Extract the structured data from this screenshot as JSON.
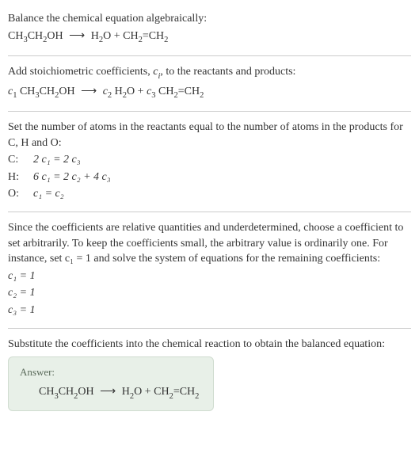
{
  "intro": {
    "line1": "Balance the chemical equation algebraically:",
    "equation_lhs": "CH",
    "equation_lhs2": "CH",
    "equation_lhs3": "OH",
    "equation_rhs1": "H",
    "equation_rhs2": "O + CH",
    "equation_rhs3": "=CH"
  },
  "step1": {
    "text": "Add stoichiometric coefficients, ",
    "ci": "c",
    "ci_sub": "i",
    "text2": ", to the reactants and products:",
    "c1": "c",
    "c2": "c",
    "c3": "c"
  },
  "step2": {
    "text": "Set the number of atoms in the reactants equal to the number of atoms in the products for C, H and O:",
    "rows": [
      {
        "label": "C:",
        "eq": "2 c₁ = 2 c₃"
      },
      {
        "label": "H:",
        "eq": "6 c₁ = 2 c₂ + 4 c₃"
      },
      {
        "label": "O:",
        "eq": "c₁ = c₂"
      }
    ]
  },
  "step3": {
    "text": "Since the coefficients are relative quantities and underdetermined, choose a coefficient to set arbitrarily. To keep the coefficients small, the arbitrary value is ordinarily one. For instance, set c₁ = 1 and solve the system of equations for the remaining coefficients:",
    "results": [
      "c₁ = 1",
      "c₂ = 1",
      "c₃ = 1"
    ]
  },
  "step4": {
    "text": "Substitute the coefficients into the chemical reaction to obtain the balanced equation:"
  },
  "answer": {
    "label": "Answer:"
  },
  "formula": {
    "ethanol_1": "CH",
    "ethanol_2": "CH",
    "ethanol_3": "OH",
    "water_1": "H",
    "water_2": "O",
    "ethylene_1": "CH",
    "ethylene_2": "=CH",
    "sub3": "3",
    "sub2": "2",
    "sub1": "1",
    "arrow": "⟶",
    "plus": " + "
  }
}
